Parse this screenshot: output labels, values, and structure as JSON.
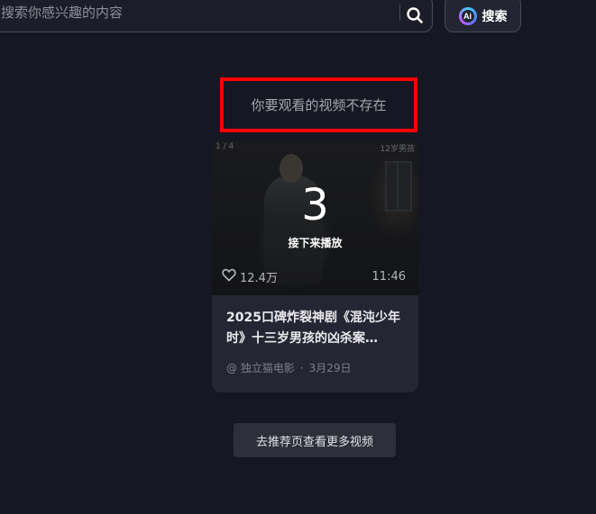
{
  "search": {
    "placeholder": "搜索你感兴趣的内容",
    "ai_button_label": "搜索",
    "ai_badge_text": "Ai"
  },
  "message": {
    "not_exist": "你要观看的视频不存在",
    "highlight_color": "#ff0000"
  },
  "video_card": {
    "counter": "1 / 4",
    "corner_label": "12岁男孩",
    "countdown": "3",
    "next_play_label": "接下来播放",
    "like_count": "12.4万",
    "duration": "11:46",
    "title": "2025口碑炸裂神剧《混沌少年时》十三岁男孩的凶杀案…",
    "author": "@ 独立猫电影",
    "separator": "·",
    "date": "3月29日"
  },
  "actions": {
    "more_button_label": "去推荐页查看更多视频"
  },
  "icons": {
    "search": "search-icon",
    "ai": "ai-search-icon",
    "like": "heart-icon"
  }
}
